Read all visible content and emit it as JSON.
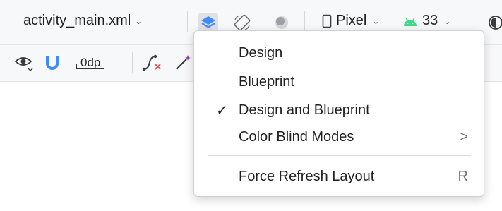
{
  "toolbar": {
    "file_name": "activity_main.xml",
    "device": "Pixel",
    "api_level": "33"
  },
  "toolbar2": {
    "default_margin": "0dp"
  },
  "menu": {
    "items": [
      {
        "label": "Design",
        "checked": false,
        "shortcut": ""
      },
      {
        "label": "Blueprint",
        "checked": false,
        "shortcut": ""
      },
      {
        "label": "Design and Blueprint",
        "checked": true,
        "check_mark": "✓",
        "shortcut": ""
      },
      {
        "label": "Color Blind Modes",
        "checked": false,
        "submenu_arrow": ">"
      },
      {
        "label": "Force Refresh Layout",
        "checked": false,
        "shortcut": "R"
      }
    ]
  },
  "colors": {
    "accent_blue": "#3d8bfd",
    "android_green": "#3ddc84",
    "warning_red": "#e05555",
    "magic_purple": "#8e44ad"
  }
}
